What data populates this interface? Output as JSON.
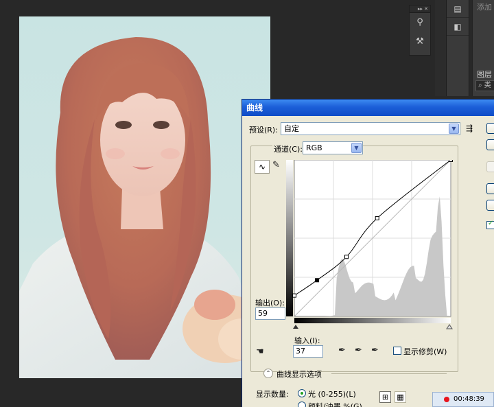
{
  "dialog": {
    "title": "曲线",
    "preset_label": "预设(R):",
    "preset_value": "自定",
    "channel_label": "通道(C):",
    "channel_value": "RGB",
    "output_label": "输出(O):",
    "output_value": "59",
    "input_label": "输入(I):",
    "input_value": "37",
    "show_clipping_label": "显示修剪(W)",
    "curve_options_label": "曲线显示选项",
    "show_amount_label": "显示数量:",
    "light_option_label": "光 (0-255)(L)",
    "pigment_option_label": "颜料/油墨 %(G)",
    "preview_checked": true
  },
  "curve": {
    "points": [
      [
        0,
        34
      ],
      [
        37,
        59
      ],
      [
        85,
        97
      ],
      [
        135,
        160
      ],
      [
        255,
        255
      ]
    ]
  },
  "timer": {
    "text": "00:48:39"
  },
  "panels": {
    "add_label": "添加",
    "layers_label": "图层",
    "search_placeholder": "类"
  },
  "colors": {
    "titlebar": "#1c5fd8",
    "dialog_bg": "#ece9d8",
    "workspace_bg": "#282828",
    "record_dot": "#e8141d"
  }
}
